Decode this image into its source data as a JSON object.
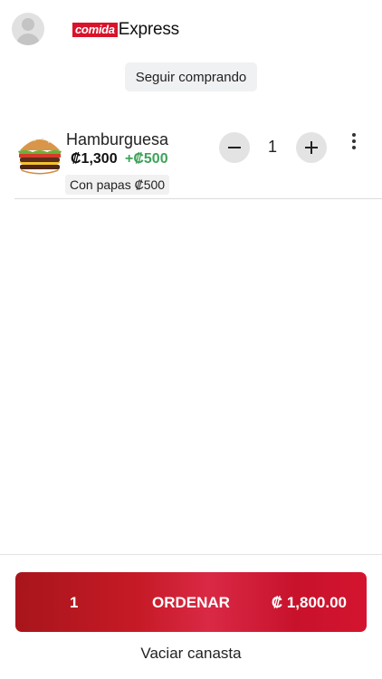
{
  "header": {
    "logo_primary": "comida",
    "logo_secondary": "Express",
    "continue_label": "Seguir comprando"
  },
  "cart": {
    "items": [
      {
        "name": "Hamburguesa",
        "price": "₡1,300",
        "extra": "+₡500",
        "option": "Con papas ₡500",
        "quantity": "1",
        "minus_icon": "minus-icon",
        "plus_icon": "plus-icon"
      }
    ]
  },
  "footer": {
    "order_count": "1",
    "order_label": "ORDENAR",
    "order_total": "₡ 1,800.00",
    "empty_label": "Vaciar canasta"
  },
  "colors": {
    "brand_red": "#d8132b",
    "extra_green": "#3fa35a"
  }
}
